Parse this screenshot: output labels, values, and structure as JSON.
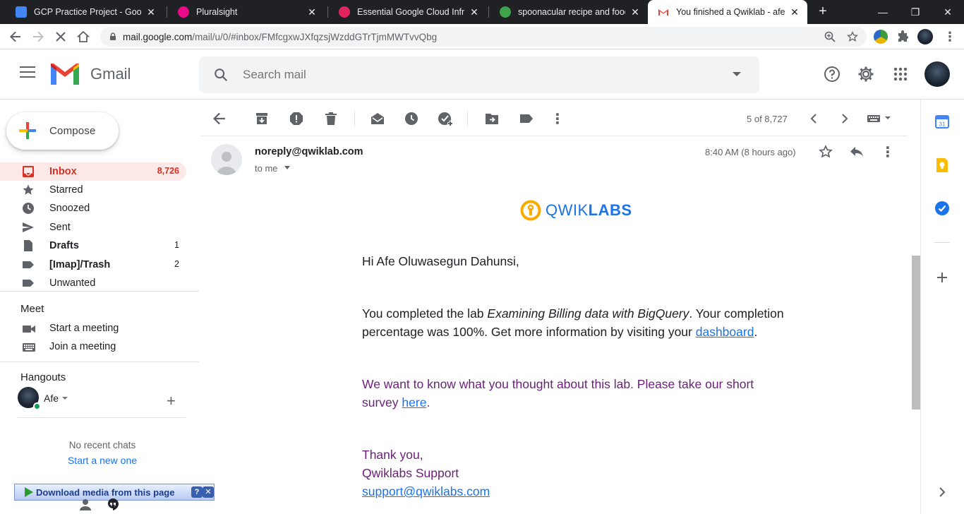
{
  "browser": {
    "tabs": [
      {
        "title": "GCP Practice Project - Google D",
        "icon": "google-docs-icon",
        "color": "#4285f4"
      },
      {
        "title": "Pluralsight",
        "icon": "pluralsight-icon",
        "color": "#e80a89"
      },
      {
        "title": "Essential Google Cloud Infrastru",
        "icon": "coursera-icon",
        "color": "#e0245e"
      },
      {
        "title": "spoonacular recipe and food API",
        "icon": "spoonacular-icon",
        "color": "#3fa34d"
      },
      {
        "title": "You finished a Qwiklab - afexzy",
        "icon": "gmail-icon",
        "color": "#ea4335"
      }
    ],
    "url_host": "mail.google.com",
    "url_path": "/mail/u/0/#inbox/FMfcgxwJXfqzsjWzddGTrTjmMWTvvQbg"
  },
  "gmail": {
    "app_name": "Gmail",
    "search_placeholder": "Search mail",
    "compose_label": "Compose",
    "nav": [
      {
        "label": "Inbox",
        "count": "8,726"
      },
      {
        "label": "Starred",
        "count": ""
      },
      {
        "label": "Snoozed",
        "count": ""
      },
      {
        "label": "Sent",
        "count": ""
      },
      {
        "label": "Drafts",
        "count": "1"
      },
      {
        "label": "[Imap]/Trash",
        "count": "2"
      },
      {
        "label": "Unwanted",
        "count": ""
      }
    ],
    "meet": {
      "heading": "Meet",
      "start": "Start a meeting",
      "join": "Join a meeting"
    },
    "hangouts": {
      "heading": "Hangouts",
      "user": "Afe",
      "no_chats": "No recent chats",
      "start_new": "Start a new one"
    },
    "download_bar": "Download media from this page",
    "pager": "5 of 8,727"
  },
  "message": {
    "sender": "noreply@qwiklab.com",
    "to": "to me",
    "time": "8:40 AM (8 hours ago)",
    "logo_a": "QWIK",
    "logo_b": "LABS",
    "greeting": "Hi Afe Oluwasegun Dahunsi,",
    "p1_before": "You completed the lab ",
    "p1_lab": "Examining Billing data with BigQuery",
    "p1_mid": ". Your completion percentage was 100%. Get more information by visiting your ",
    "p1_link": "dashboard",
    "p1_end": ".",
    "p2_before": "We want to know what you thought about this lab. Please take our short survey ",
    "p2_link": "here",
    "p2_end": ".",
    "thanks": "Thank you,",
    "team": "Qwiklabs Support",
    "support_email": "support@qwiklabs.com"
  },
  "colors": {
    "inbox_active": "#d93025",
    "inbox_bg": "#fce8e6",
    "link": "#1a73e8",
    "purple_text": "#6b1f7a",
    "qwiklabs_yellow": "#f9ab00"
  }
}
